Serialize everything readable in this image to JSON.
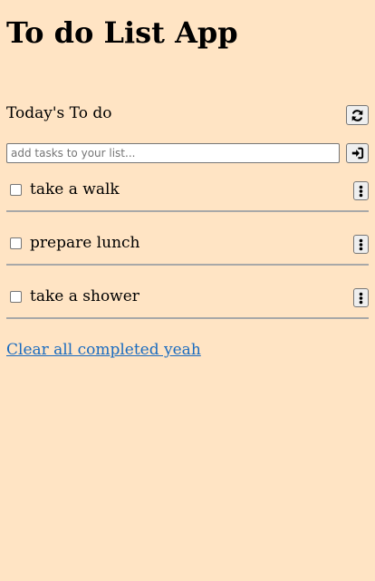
{
  "app": {
    "title": "To do List App"
  },
  "section": {
    "title": "Today's To do",
    "refresh_icon": "refresh-icon"
  },
  "new_task": {
    "value": "",
    "placeholder": "add tasks to your list...",
    "add_icon": "sign-in-icon"
  },
  "tasks": [
    {
      "text": "take a walk",
      "completed": false,
      "menu_icon": "vertical-ellipsis-icon"
    },
    {
      "text": "prepare lunch",
      "completed": false,
      "menu_icon": "vertical-ellipsis-icon"
    },
    {
      "text": "take a shower",
      "completed": false,
      "menu_icon": "vertical-ellipsis-icon"
    }
  ],
  "footer": {
    "clear_label": "Clear all completed yeah"
  },
  "colors": {
    "background": "#ffe4c4",
    "link": "#1a6bbf",
    "divider": "#a8a8a8"
  }
}
